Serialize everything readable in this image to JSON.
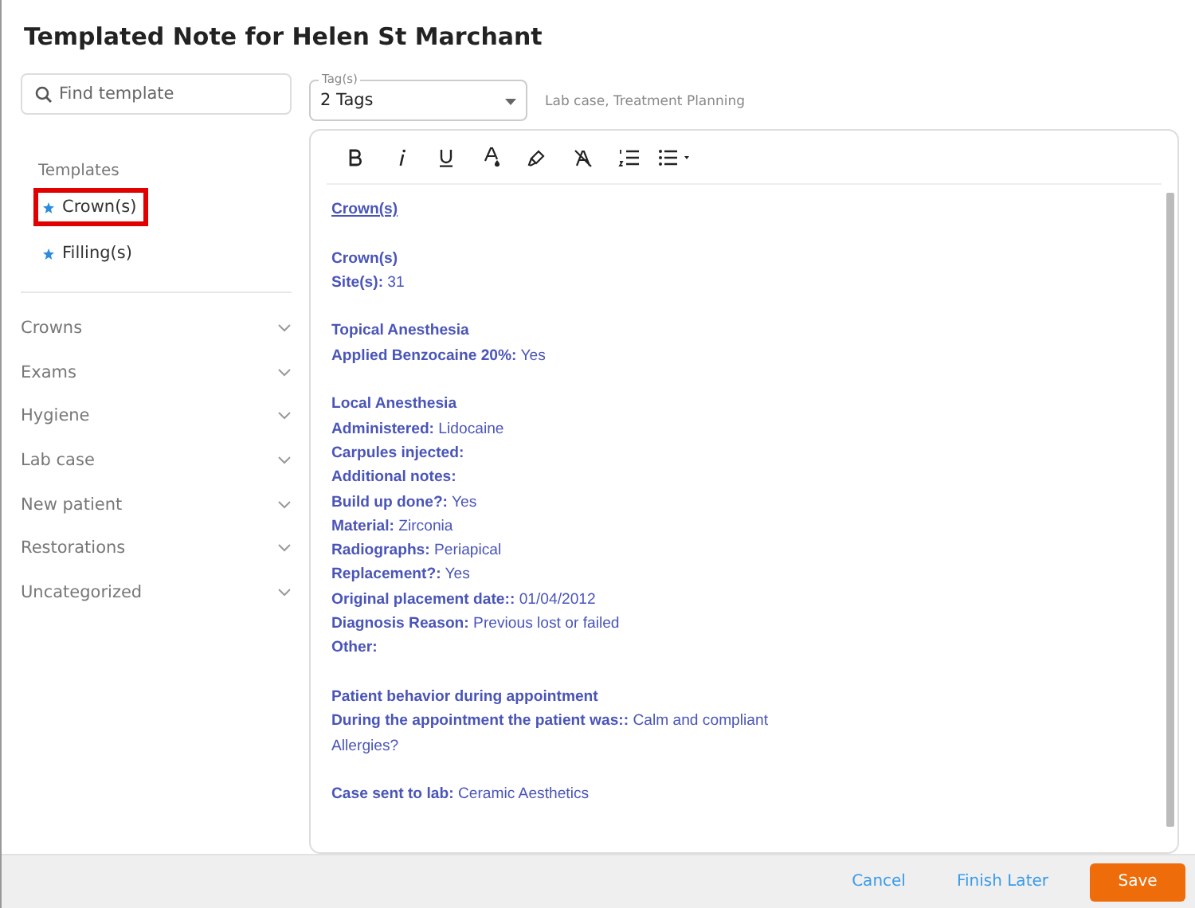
{
  "window": {
    "title": "Templated Note for Helen St Marchant"
  },
  "search": {
    "placeholder": "Find template"
  },
  "templates": {
    "heading": "Templates",
    "items": [
      {
        "label": "Crown(s)",
        "starred": true,
        "selected": true
      },
      {
        "label": "Filling(s)",
        "starred": true,
        "selected": false
      }
    ]
  },
  "categories": [
    {
      "label": "Crowns",
      "expanded": false
    },
    {
      "label": "Exams",
      "expanded": false
    },
    {
      "label": "Hygiene",
      "expanded": false
    },
    {
      "label": "Lab case",
      "expanded": false
    },
    {
      "label": "New patient",
      "expanded": false
    },
    {
      "label": "Restorations",
      "expanded": false
    },
    {
      "label": "Uncategorized",
      "expanded": false
    }
  ],
  "tags": {
    "label": "Tag(s)",
    "value": "2 Tags",
    "summary": "Lab case, Treatment Planning"
  },
  "note": {
    "blocks": [
      [
        {
          "kind": "heading",
          "label": "Crown(s)"
        }
      ],
      [
        {
          "kind": "title",
          "label": "Crown(s)"
        },
        {
          "kind": "field",
          "label": "Site(s):",
          "value": "31"
        }
      ],
      [
        {
          "kind": "title",
          "label": "Topical Anesthesia"
        },
        {
          "kind": "field",
          "label": "Applied Benzocaine 20%:",
          "value": "Yes"
        }
      ],
      [
        {
          "kind": "title",
          "label": "Local Anesthesia"
        },
        {
          "kind": "field",
          "label": "Administered:",
          "value": "Lidocaine"
        },
        {
          "kind": "field",
          "label": "Carpules injected:"
        },
        {
          "kind": "field",
          "label": "Additional notes:"
        },
        {
          "kind": "field",
          "label": "Build up done?:",
          "value": "Yes"
        },
        {
          "kind": "field",
          "label": "Material:",
          "value": "Zirconia"
        },
        {
          "kind": "field",
          "label": "Radiographs:",
          "value": "Periapical"
        },
        {
          "kind": "field",
          "label": "Replacement?:",
          "value": "Yes"
        },
        {
          "kind": "field",
          "label": "Original placement date::",
          "value": "01/04/2012"
        },
        {
          "kind": "field",
          "label": "Diagnosis Reason:",
          "value": "Previous lost or failed"
        },
        {
          "kind": "field",
          "label": "Other:"
        }
      ],
      [
        {
          "kind": "title",
          "label": "Patient behavior during appointment"
        },
        {
          "kind": "field",
          "label": "During the appointment the patient was::",
          "value": "Calm and compliant"
        },
        {
          "kind": "text",
          "value": "Allergies?"
        }
      ],
      [
        {
          "kind": "field",
          "label": "Case sent to lab:",
          "value": "Ceramic Aesthetics"
        }
      ]
    ]
  },
  "buttons": [
    {
      "label": "Cancel",
      "kind": "link"
    },
    {
      "label": "Finish Later",
      "kind": "link"
    },
    {
      "label": "Save",
      "kind": "primary"
    }
  ]
}
